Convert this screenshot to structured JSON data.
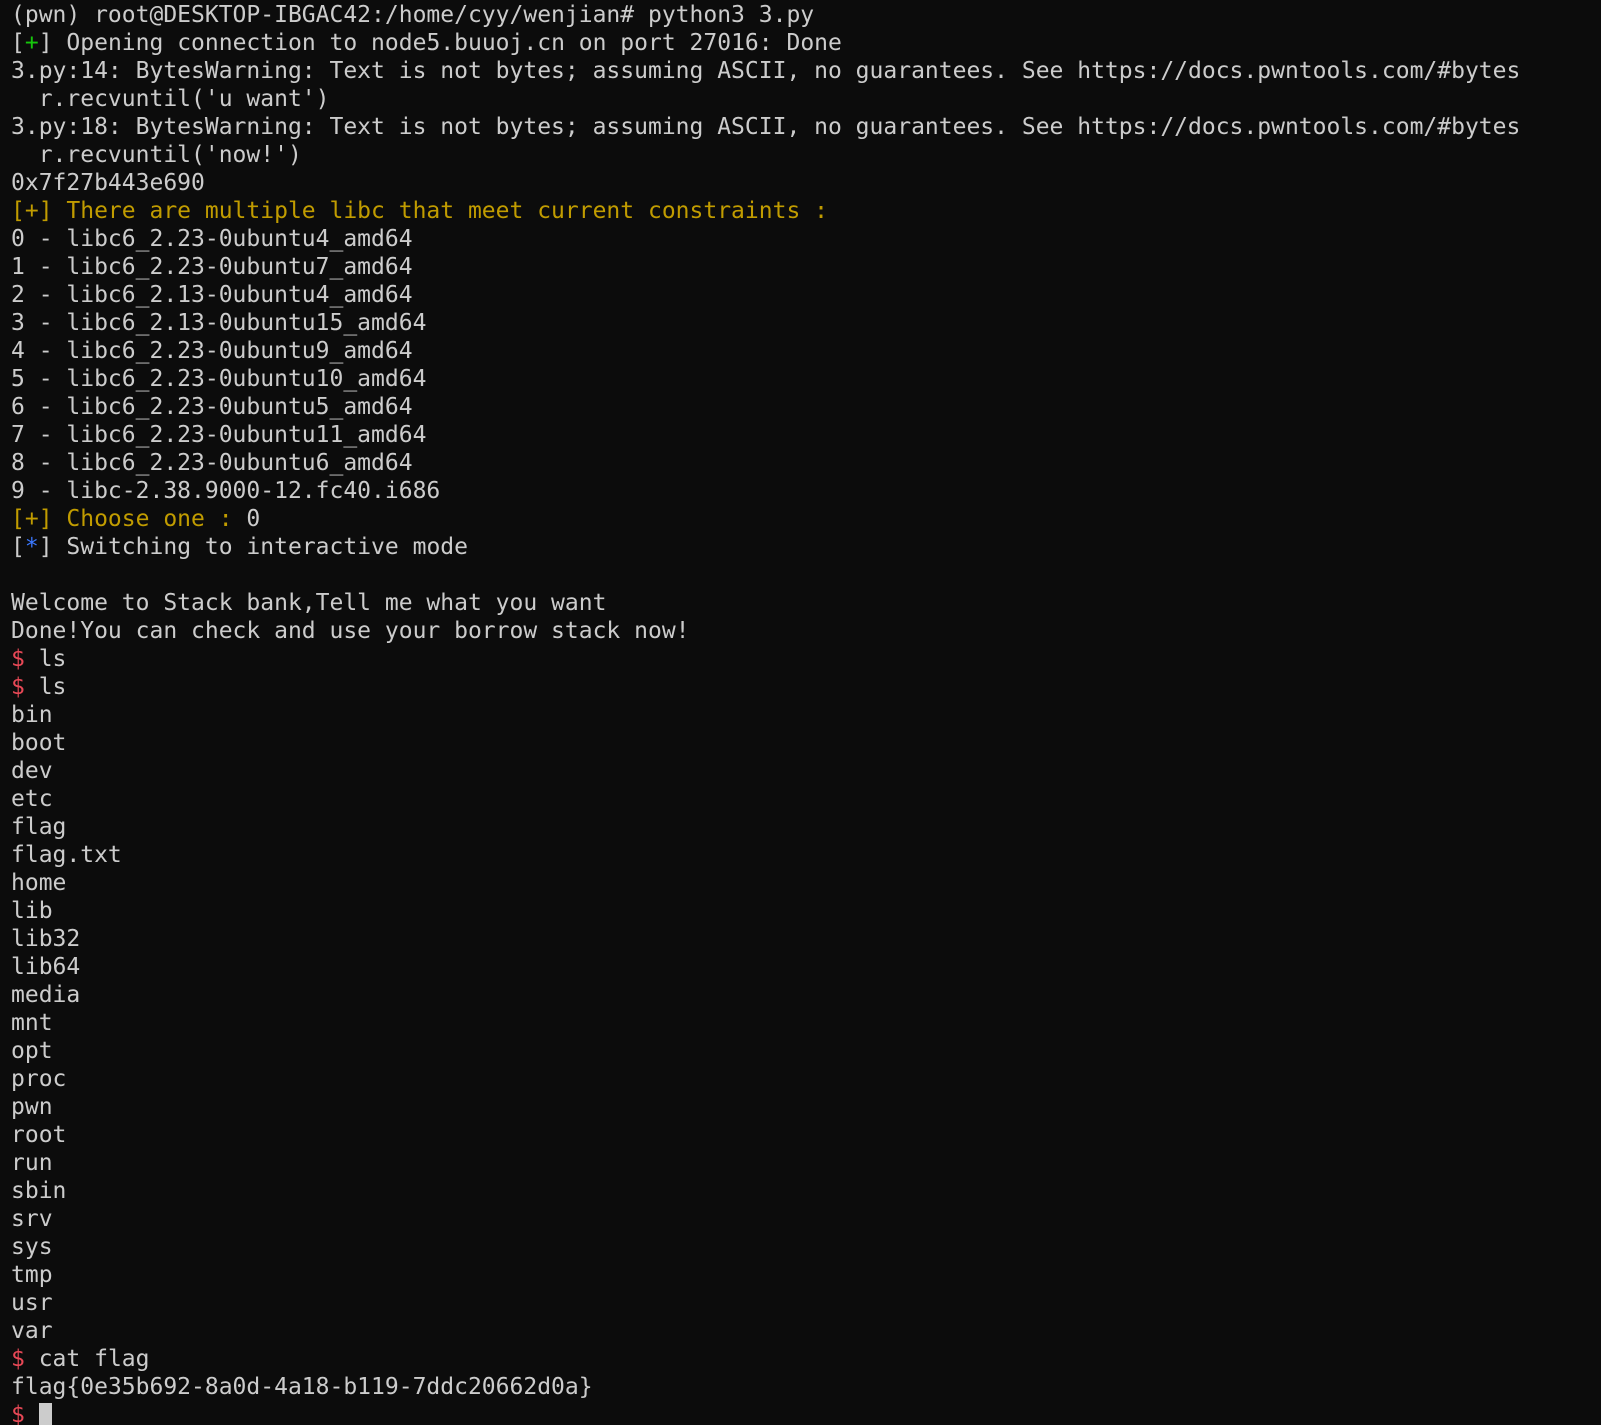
{
  "window": {
    "type": "terminal",
    "background": "#0c0c0c",
    "foreground": "#cccccc"
  },
  "colors": {
    "default": "#cccccc",
    "success": "#16c60c",
    "warning": "#c19c00",
    "info": "#3b78ff",
    "prompt": "#e74856",
    "cursor": "#cccccc"
  },
  "lines": [
    {
      "name": "shell-command-line",
      "segments": [
        {
          "text": "(pwn) root@DESKTOP-IBGAC42:/home/cyy/wenjian# python3 3.py"
        }
      ]
    },
    {
      "name": "connection-status-line",
      "segments": [
        {
          "text": "["
        },
        {
          "text": "+",
          "color": "success"
        },
        {
          "text": "] Opening connection to node5.buuoj.cn on port 27016: Done"
        }
      ]
    },
    {
      "name": "warning-line",
      "segments": [
        {
          "text": "3.py:14: BytesWarning: Text is not bytes; assuming ASCII, no guarantees. See https://docs.pwntools.com/#bytes"
        }
      ]
    },
    {
      "name": "warning-source-line",
      "segments": [
        {
          "text": "  r.recvuntil('u want')"
        }
      ]
    },
    {
      "name": "warning-line",
      "segments": [
        {
          "text": "3.py:18: BytesWarning: Text is not bytes; assuming ASCII, no guarantees. See https://docs.pwntools.com/#bytes"
        }
      ]
    },
    {
      "name": "warning-source-line",
      "segments": [
        {
          "text": "  r.recvuntil('now!')"
        }
      ]
    },
    {
      "name": "leaked-address-line",
      "segments": [
        {
          "text": "0x7f27b443e690"
        }
      ]
    },
    {
      "name": "libc-notice-line",
      "segments": [
        {
          "text": "[+] There are multiple libc that meet current constraints :",
          "color": "warning"
        }
      ]
    },
    {
      "name": "libc-option-line",
      "segments": [
        {
          "text": "0 - libc6_2.23-0ubuntu4_amd64"
        }
      ]
    },
    {
      "name": "libc-option-line",
      "segments": [
        {
          "text": "1 - libc6_2.23-0ubuntu7_amd64"
        }
      ]
    },
    {
      "name": "libc-option-line",
      "segments": [
        {
          "text": "2 - libc6_2.13-0ubuntu4_amd64"
        }
      ]
    },
    {
      "name": "libc-option-line",
      "segments": [
        {
          "text": "3 - libc6_2.13-0ubuntu15_amd64"
        }
      ]
    },
    {
      "name": "libc-option-line",
      "segments": [
        {
          "text": "4 - libc6_2.23-0ubuntu9_amd64"
        }
      ]
    },
    {
      "name": "libc-option-line",
      "segments": [
        {
          "text": "5 - libc6_2.23-0ubuntu10_amd64"
        }
      ]
    },
    {
      "name": "libc-option-line",
      "segments": [
        {
          "text": "6 - libc6_2.23-0ubuntu5_amd64"
        }
      ]
    },
    {
      "name": "libc-option-line",
      "segments": [
        {
          "text": "7 - libc6_2.23-0ubuntu11_amd64"
        }
      ]
    },
    {
      "name": "libc-option-line",
      "segments": [
        {
          "text": "8 - libc6_2.23-0ubuntu6_amd64"
        }
      ]
    },
    {
      "name": "libc-option-line",
      "segments": [
        {
          "text": "9 - libc-2.38.9000-12.fc40.i686"
        }
      ]
    },
    {
      "name": "libc-choice-line",
      "segments": [
        {
          "text": "[+] Choose one : ",
          "color": "warning"
        },
        {
          "text": "0"
        }
      ]
    },
    {
      "name": "interactive-mode-line",
      "segments": [
        {
          "text": "["
        },
        {
          "text": "*",
          "color": "info"
        },
        {
          "text": "] Switching to interactive mode"
        }
      ]
    },
    {
      "name": "blank-line",
      "segments": [
        {
          "text": ""
        }
      ]
    },
    {
      "name": "program-output-line",
      "segments": [
        {
          "text": "Welcome to Stack bank,Tell me what you want"
        }
      ]
    },
    {
      "name": "program-output-line",
      "segments": [
        {
          "text": "Done!You can check and use your borrow stack now!"
        }
      ]
    },
    {
      "name": "shell-input-line",
      "segments": [
        {
          "text": "$ ",
          "color": "prompt"
        },
        {
          "text": "ls"
        }
      ]
    },
    {
      "name": "shell-input-line",
      "segments": [
        {
          "text": "$ ",
          "color": "prompt"
        },
        {
          "text": "ls"
        }
      ]
    },
    {
      "name": "directory-entry",
      "segments": [
        {
          "text": "bin"
        }
      ]
    },
    {
      "name": "directory-entry",
      "segments": [
        {
          "text": "boot"
        }
      ]
    },
    {
      "name": "directory-entry",
      "segments": [
        {
          "text": "dev"
        }
      ]
    },
    {
      "name": "directory-entry",
      "segments": [
        {
          "text": "etc"
        }
      ]
    },
    {
      "name": "directory-entry",
      "segments": [
        {
          "text": "flag"
        }
      ]
    },
    {
      "name": "directory-entry",
      "segments": [
        {
          "text": "flag.txt"
        }
      ]
    },
    {
      "name": "directory-entry",
      "segments": [
        {
          "text": "home"
        }
      ]
    },
    {
      "name": "directory-entry",
      "segments": [
        {
          "text": "lib"
        }
      ]
    },
    {
      "name": "directory-entry",
      "segments": [
        {
          "text": "lib32"
        }
      ]
    },
    {
      "name": "directory-entry",
      "segments": [
        {
          "text": "lib64"
        }
      ]
    },
    {
      "name": "directory-entry",
      "segments": [
        {
          "text": "media"
        }
      ]
    },
    {
      "name": "directory-entry",
      "segments": [
        {
          "text": "mnt"
        }
      ]
    },
    {
      "name": "directory-entry",
      "segments": [
        {
          "text": "opt"
        }
      ]
    },
    {
      "name": "directory-entry",
      "segments": [
        {
          "text": "proc"
        }
      ]
    },
    {
      "name": "directory-entry",
      "segments": [
        {
          "text": "pwn"
        }
      ]
    },
    {
      "name": "directory-entry",
      "segments": [
        {
          "text": "root"
        }
      ]
    },
    {
      "name": "directory-entry",
      "segments": [
        {
          "text": "run"
        }
      ]
    },
    {
      "name": "directory-entry",
      "segments": [
        {
          "text": "sbin"
        }
      ]
    },
    {
      "name": "directory-entry",
      "segments": [
        {
          "text": "srv"
        }
      ]
    },
    {
      "name": "directory-entry",
      "segments": [
        {
          "text": "sys"
        }
      ]
    },
    {
      "name": "directory-entry",
      "segments": [
        {
          "text": "tmp"
        }
      ]
    },
    {
      "name": "directory-entry",
      "segments": [
        {
          "text": "usr"
        }
      ]
    },
    {
      "name": "directory-entry",
      "segments": [
        {
          "text": "var"
        }
      ]
    },
    {
      "name": "shell-input-line",
      "segments": [
        {
          "text": "$ ",
          "color": "prompt"
        },
        {
          "text": "cat flag"
        }
      ]
    },
    {
      "name": "flag-output-line",
      "segments": [
        {
          "text": "flag{0e35b692-8a0d-4a18-b119-7ddc20662d0a}"
        }
      ]
    },
    {
      "name": "active-prompt-line",
      "segments": [
        {
          "text": "$ ",
          "color": "prompt"
        }
      ],
      "cursor": true
    }
  ]
}
